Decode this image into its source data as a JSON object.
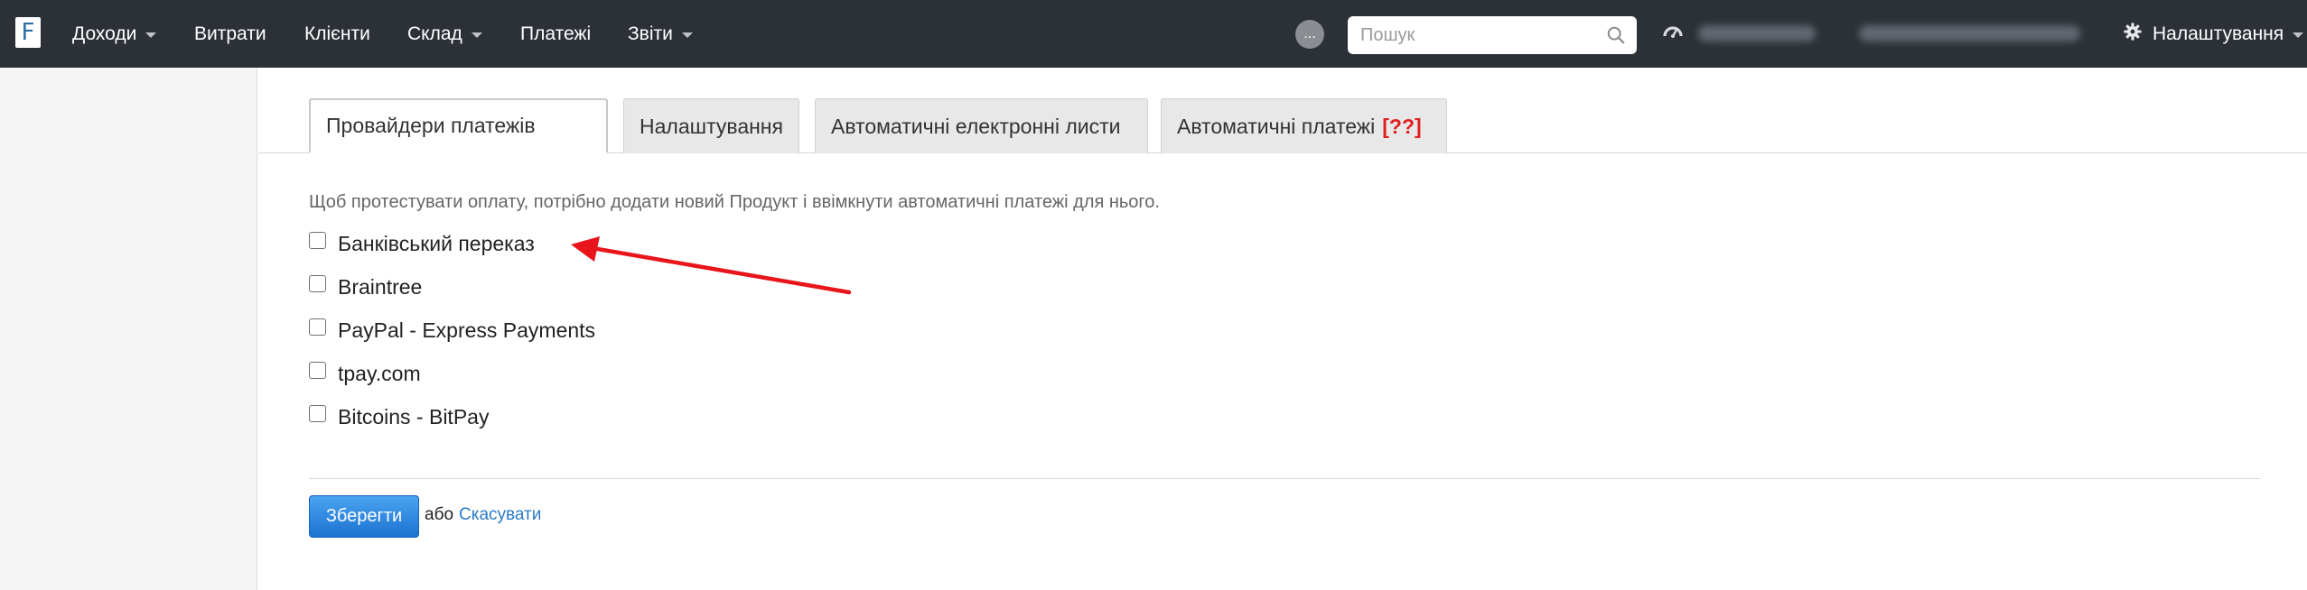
{
  "app": {
    "logo_letter": "F"
  },
  "nav": {
    "items": [
      {
        "label": "Доходи",
        "dropdown": true
      },
      {
        "label": "Витрати",
        "dropdown": false
      },
      {
        "label": "Клієнти",
        "dropdown": false
      },
      {
        "label": "Склад",
        "dropdown": true
      },
      {
        "label": "Платежі",
        "dropdown": false
      },
      {
        "label": "Звіти",
        "dropdown": true
      }
    ],
    "dots_label": "...",
    "search_placeholder": "Пошук",
    "settings_label": "Налаштування"
  },
  "tabs": [
    {
      "label": "Провайдери платежів",
      "active": true
    },
    {
      "label": "Налаштування",
      "active": false
    },
    {
      "label": "Автоматичні електронні листи",
      "active": false
    },
    {
      "label": "Автоматичні платежі",
      "warning": "[??]",
      "active": false
    }
  ],
  "hint_text": "Щоб протестувати оплату, потрібно додати новий Продукт і ввімкнути автоматичні платежі для нього.",
  "providers": [
    {
      "label": "Банківський переказ",
      "checked": false
    },
    {
      "label": "Braintree",
      "checked": false
    },
    {
      "label": "PayPal - Express Payments",
      "checked": false
    },
    {
      "label": "tpay.com",
      "checked": false
    },
    {
      "label": "Bitcoins - BitPay",
      "checked": false
    }
  ],
  "actions": {
    "save_label": "Зберегти",
    "or_text": "або",
    "cancel_label": "Скасувати"
  },
  "colors": {
    "navbar_bg": "#2c3138",
    "primary_button": "#1b73d1",
    "link": "#2a7ac9",
    "warning": "#e02020",
    "annotation_arrow": "#e8151b"
  },
  "icons": [
    "search-icon",
    "dashboard-icon",
    "gear-icon",
    "caret-down-icon",
    "arrow-annotation"
  ]
}
